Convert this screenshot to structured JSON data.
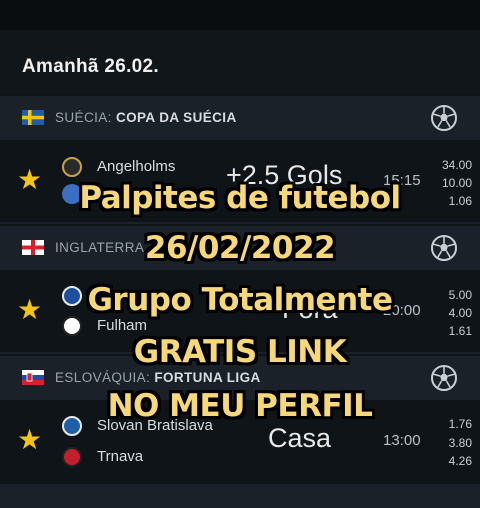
{
  "date_header": "Amanhã 26.02.",
  "leagues": [
    {
      "country": "SUÉCIA:",
      "competition": "COPA DA SUÉCIA",
      "match": {
        "home": "Angelholms",
        "away": "",
        "time": "15:15",
        "odds": [
          "34.00",
          "10.00",
          "1.06"
        ]
      }
    },
    {
      "country": "INGLATERRA",
      "competition": "",
      "match": {
        "home": "",
        "away": "Fulham",
        "time": "20:00",
        "odds": [
          "5.00",
          "4.00",
          "1.61"
        ]
      }
    },
    {
      "country": "ESLOVÁQUIA:",
      "competition": "FORTUNA LIGA",
      "match": {
        "home": "Slovan Bratislava",
        "away": "Trnava",
        "time": "13:00",
        "odds": [
          "1.76",
          "3.80",
          "4.26"
        ]
      }
    }
  ],
  "background_tips": [
    "+2.5 Gols",
    "Fora",
    "Casa"
  ],
  "overlay_lines": [
    "Palpites de futebol",
    "26/02/2022",
    "Grupo Totalmente",
    "GRATIS  LINK",
    "NO MEU PERFIL"
  ],
  "colors": {
    "star": "#f3c318",
    "overlay_text": "#f6d77a",
    "league_bar": "#1a2128",
    "background": "#0f1419"
  }
}
